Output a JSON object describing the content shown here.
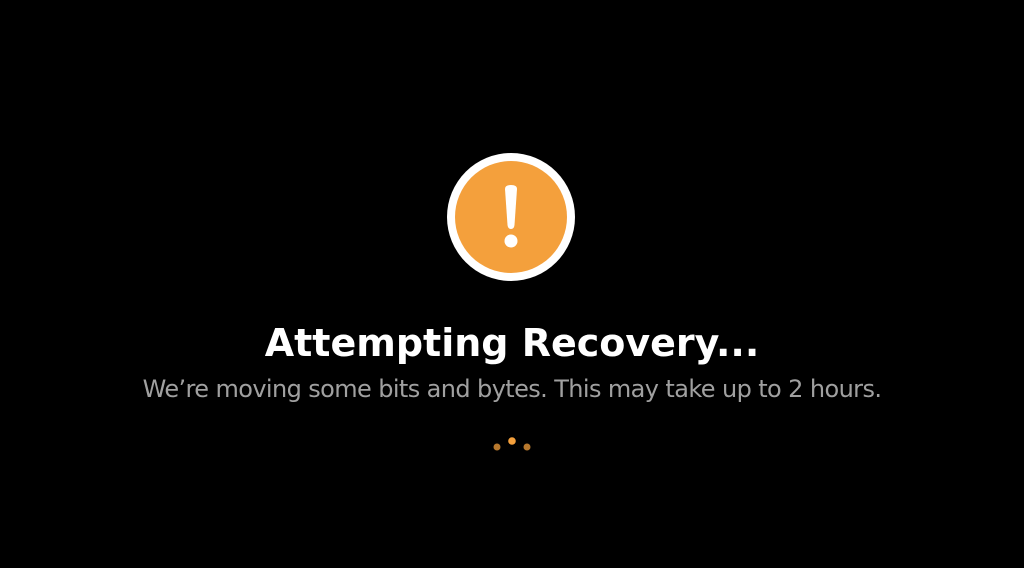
{
  "recovery": {
    "title": "Attempting Recovery...",
    "message": "We’re moving some bits and bytes. This may take up to 2 hours."
  },
  "icons": {
    "status": "exclamation-alert-icon",
    "progress": "loading-dots-icon"
  },
  "colors": {
    "background": "#000000",
    "accent": "#f4a03c",
    "ring": "#ffffff",
    "title": "#ffffff",
    "message": "#a0a0a0"
  }
}
